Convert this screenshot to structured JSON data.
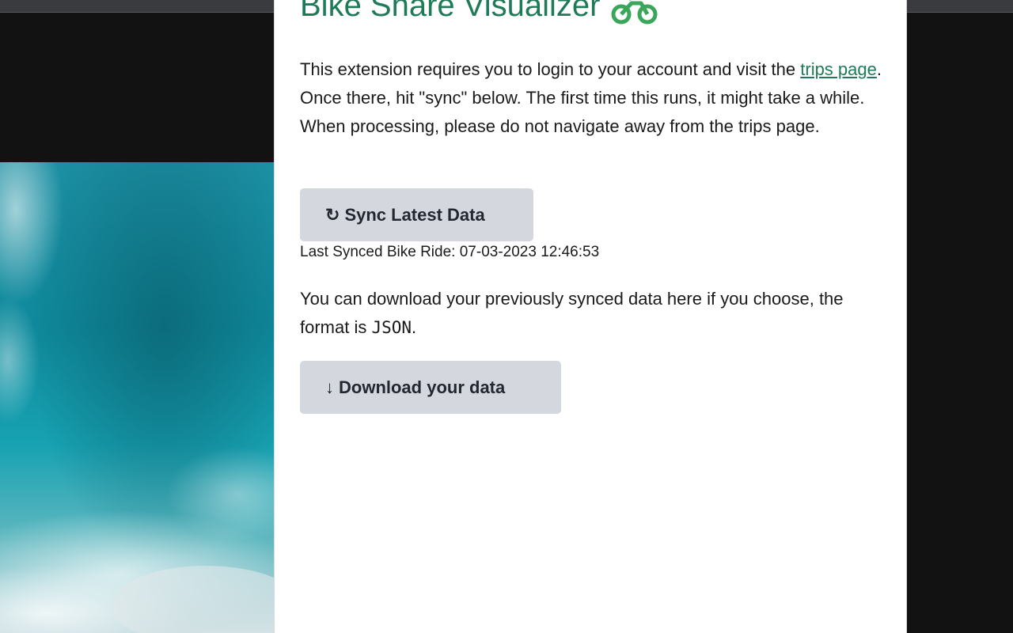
{
  "popup": {
    "title": "Bike Share Visualizer",
    "title_color": "#1e7a57",
    "title_icon": "bike-icon",
    "intro_text_before": "This extension requires you to login to your account and visit the ",
    "trips_link_label": "trips page",
    "intro_text_after": ". Once there, hit \"sync\" below. The first time this runs, it might take a while. When processing, please do not navigate away from the trips page.",
    "sync_button": {
      "icon": "refresh-icon",
      "icon_glyph": "↻",
      "label": "Sync Latest Data"
    },
    "last_synced": {
      "label": "Last Synced Bike Ride:",
      "value": "07-03-2023 12:46:53"
    },
    "download_text_before": "You can download your previously synced data here if you choose, the format is ",
    "download_format": "JSON",
    "download_text_after": ".",
    "download_button": {
      "icon": "arrow-down-icon",
      "icon_glyph": "↓",
      "label": "Download your data"
    },
    "button_bg": "#d5d7de"
  },
  "background": {
    "image": "ocean-waves-photo",
    "dark_color": "#121212"
  }
}
